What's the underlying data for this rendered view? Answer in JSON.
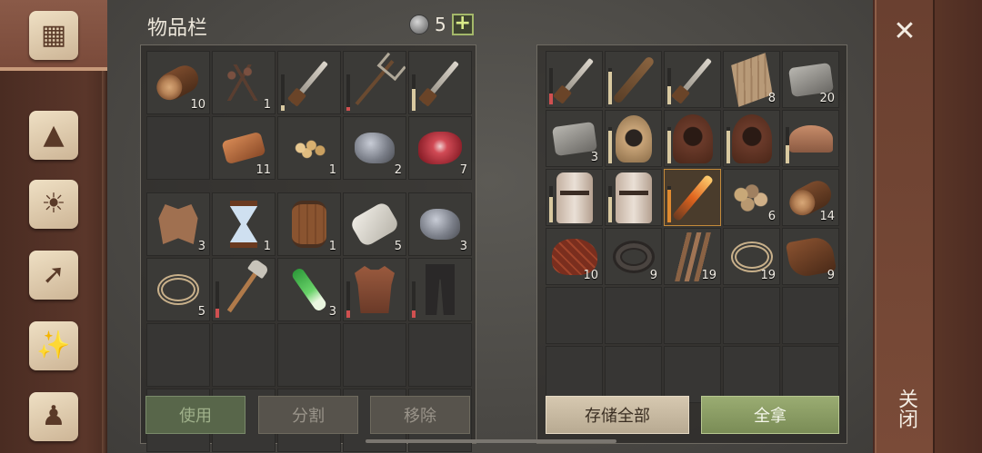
{
  "header": {
    "title": "物品栏",
    "currency_count": "5",
    "plus_label": "+"
  },
  "close": {
    "x_symbol": "✕",
    "label": "关闭"
  },
  "sidebar": {
    "tabs": [
      {
        "icon": "chest-icon",
        "active": true
      },
      {
        "icon": "wolf-icon",
        "active": false
      },
      {
        "icon": "sun-book-icon",
        "active": false
      },
      {
        "icon": "map-icon",
        "active": false
      },
      {
        "icon": "scroll-icon",
        "active": false
      },
      {
        "icon": "character-icon",
        "active": false
      }
    ]
  },
  "inventory": {
    "upper": [
      {
        "name": "log",
        "qty": "10",
        "shape": "log"
      },
      {
        "name": "nails",
        "qty": "1",
        "shape": "nails"
      },
      {
        "name": "knife",
        "qty": "",
        "shape": "blade",
        "durability": 0.15,
        "dur_color": "#d9c9a0"
      },
      {
        "name": "pitchfork",
        "qty": "",
        "shape": "pitchfork",
        "durability": 0.1,
        "dur_color": "#d05050"
      },
      {
        "name": "dagger",
        "qty": "",
        "shape": "blade",
        "durability": 0.6,
        "dur_color": "#d9c9a0"
      },
      {
        "name": "empty",
        "qty": "",
        "shape": ""
      },
      {
        "name": "copper-bar",
        "qty": "11",
        "shape": "bar"
      },
      {
        "name": "seeds",
        "qty": "1",
        "shape": "seeds"
      },
      {
        "name": "ore",
        "qty": "2",
        "shape": "ore"
      },
      {
        "name": "raw-meat",
        "qty": "7",
        "shape": "meat"
      }
    ],
    "lower": [
      {
        "name": "hide",
        "qty": "3",
        "shape": "hide"
      },
      {
        "name": "hourglass",
        "qty": "1",
        "shape": "hourglass"
      },
      {
        "name": "barrel",
        "qty": "1",
        "shape": "barrel"
      },
      {
        "name": "cloth",
        "qty": "5",
        "shape": "cloth"
      },
      {
        "name": "copper-ore",
        "qty": "3",
        "shape": "ore"
      },
      {
        "name": "rope",
        "qty": "5",
        "shape": "rope"
      },
      {
        "name": "shovel",
        "qty": "",
        "shape": "tool",
        "durability": 0.25,
        "dur_color": "#d05050"
      },
      {
        "name": "leek",
        "qty": "3",
        "shape": "leek"
      },
      {
        "name": "leather-vest",
        "qty": "",
        "shape": "vest",
        "durability": 0.2,
        "dur_color": "#d05050"
      },
      {
        "name": "pants",
        "qty": "",
        "shape": "pants",
        "durability": 0.2,
        "dur_color": "#d05050"
      },
      {
        "name": "empty",
        "qty": "",
        "shape": ""
      },
      {
        "name": "empty",
        "qty": "",
        "shape": ""
      },
      {
        "name": "empty",
        "qty": "",
        "shape": ""
      },
      {
        "name": "empty",
        "qty": "",
        "shape": ""
      },
      {
        "name": "empty",
        "qty": "",
        "shape": ""
      },
      {
        "name": "empty",
        "qty": "",
        "shape": ""
      },
      {
        "name": "empty",
        "qty": "",
        "shape": ""
      },
      {
        "name": "empty",
        "qty": "",
        "shape": ""
      },
      {
        "name": "empty",
        "qty": "",
        "shape": ""
      },
      {
        "name": "empty",
        "qty": "",
        "shape": ""
      }
    ]
  },
  "storage": {
    "slots": [
      {
        "name": "sword",
        "qty": "",
        "shape": "blade",
        "durability": 0.3,
        "dur_color": "#d05050"
      },
      {
        "name": "spiked-club",
        "qty": "",
        "shape": "spikeclub",
        "durability": 0.9,
        "dur_color": "#d9c9a0"
      },
      {
        "name": "longsword",
        "qty": "",
        "shape": "blade",
        "durability": 0.5,
        "dur_color": "#d9c9a0"
      },
      {
        "name": "planks",
        "qty": "8",
        "shape": "plank"
      },
      {
        "name": "stone",
        "qty": "20",
        "shape": "stone"
      },
      {
        "name": "stone-block",
        "qty": "3",
        "shape": "stone"
      },
      {
        "name": "tan-hood",
        "qty": "",
        "shape": "hoodtan",
        "durability": 0.9,
        "dur_color": "#d9c9a0"
      },
      {
        "name": "leather-hood",
        "qty": "",
        "shape": "hood",
        "durability": 0.9,
        "dur_color": "#d9c9a0"
      },
      {
        "name": "dark-hood",
        "qty": "",
        "shape": "hood",
        "durability": 0.9,
        "dur_color": "#d9c9a0"
      },
      {
        "name": "helmet",
        "qty": "",
        "shape": "helmet",
        "durability": 0.5,
        "dur_color": "#d9c9a0"
      },
      {
        "name": "great-helm",
        "qty": "",
        "shape": "greathelm",
        "durability": 0.7,
        "dur_color": "#d9c9a0"
      },
      {
        "name": "great-helm-2",
        "qty": "",
        "shape": "greathelm",
        "durability": 0.7,
        "dur_color": "#d9c9a0"
      },
      {
        "name": "fire-sword",
        "qty": "",
        "shape": "flame",
        "durability": 0.9,
        "dur_color": "#e08a30",
        "highlight": true
      },
      {
        "name": "pebbles",
        "qty": "6",
        "shape": "pebbles"
      },
      {
        "name": "log",
        "qty": "14",
        "shape": "log"
      },
      {
        "name": "steak",
        "qty": "10",
        "shape": "steak"
      },
      {
        "name": "cord",
        "qty": "9",
        "shape": "cord"
      },
      {
        "name": "fiber",
        "qty": "19",
        "shape": "fiber"
      },
      {
        "name": "rope",
        "qty": "19",
        "shape": "rope"
      },
      {
        "name": "leather",
        "qty": "9",
        "shape": "leather"
      },
      {
        "name": "empty",
        "qty": "",
        "shape": ""
      },
      {
        "name": "empty",
        "qty": "",
        "shape": ""
      },
      {
        "name": "empty",
        "qty": "",
        "shape": ""
      },
      {
        "name": "empty",
        "qty": "",
        "shape": ""
      },
      {
        "name": "empty",
        "qty": "",
        "shape": ""
      },
      {
        "name": "empty",
        "qty": "",
        "shape": ""
      },
      {
        "name": "empty",
        "qty": "",
        "shape": ""
      },
      {
        "name": "empty",
        "qty": "",
        "shape": ""
      },
      {
        "name": "empty",
        "qty": "",
        "shape": ""
      },
      {
        "name": "empty",
        "qty": "",
        "shape": ""
      }
    ]
  },
  "buttons": {
    "use": "使用",
    "split": "分割",
    "remove": "移除",
    "store_all": "存储全部",
    "take_all": "全拿"
  }
}
